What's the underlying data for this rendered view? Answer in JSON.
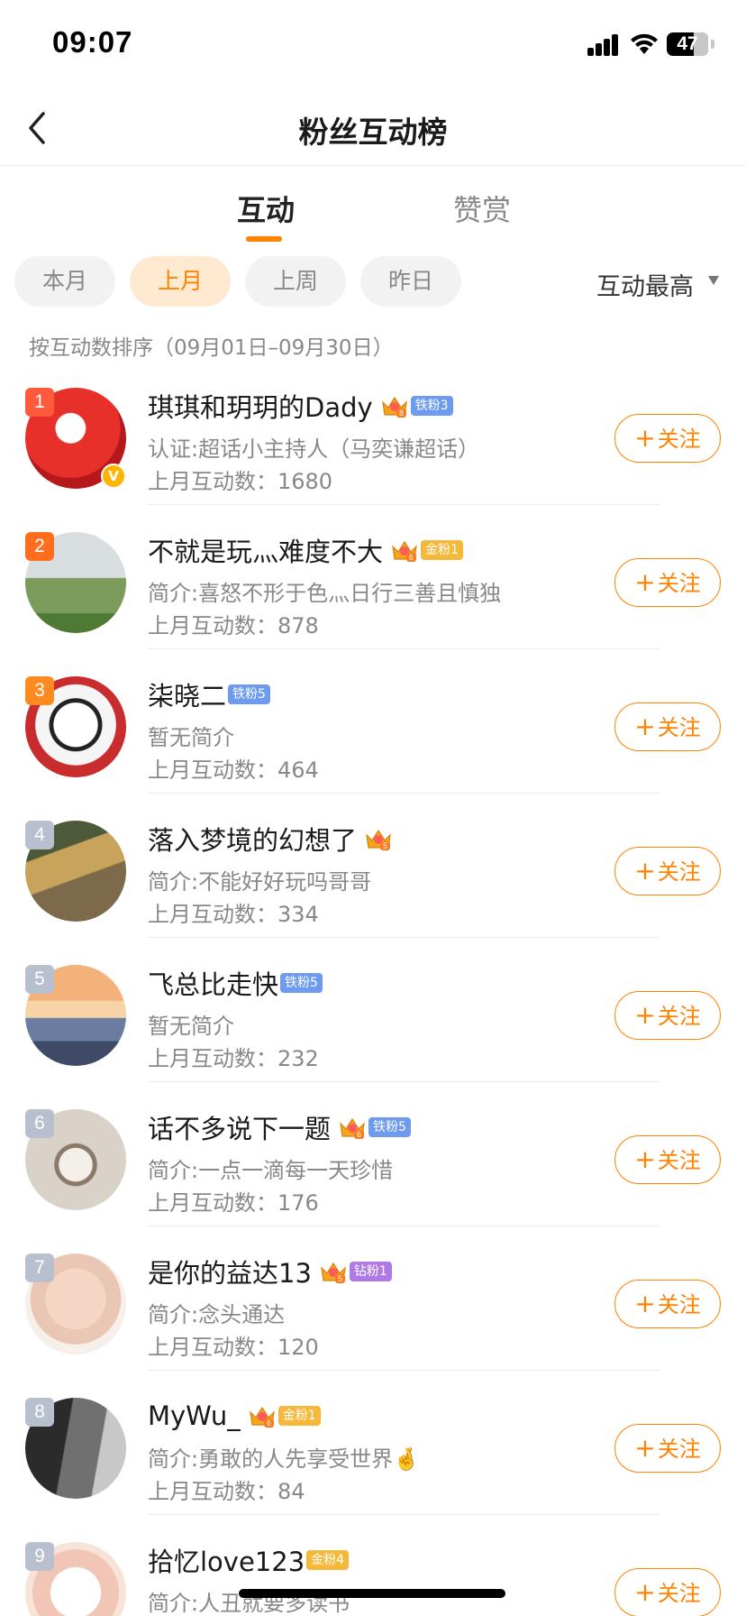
{
  "status_bar": {
    "time": "09:07",
    "battery": "47"
  },
  "nav": {
    "title": "粉丝互动榜"
  },
  "tabs": [
    {
      "label": "互动"
    },
    {
      "label": "赞赏"
    }
  ],
  "filters": {
    "chips": [
      "本月",
      "上月",
      "上周",
      "昨日"
    ],
    "active": "上月",
    "sort_label": "互动最高"
  },
  "date_range": "按互动数排序（09月01日–09月30日）",
  "follow_label": "关注",
  "colors": {
    "accent": "#ff8200",
    "rank_top": "#ff6d1f",
    "rank_other": "#b8bfcf"
  },
  "fans": [
    {
      "rank": "1",
      "name": "琪琪和玥玥的Dady",
      "crown_level": "8",
      "badge": "铁粉3",
      "badge_type": "iron",
      "desc": "认证:超话小主持人（马奕谦超话）",
      "count": "上月互动数：1680",
      "verified": true
    },
    {
      "rank": "2",
      "name": "不就是玩灬难度不大",
      "crown_level": "6",
      "badge": "金粉1",
      "badge_type": "gold",
      "desc": "简介:喜怒不形于色灬日行三善且慎独",
      "count": "上月互动数：878"
    },
    {
      "rank": "3",
      "name": "柒晓二",
      "crown_level": "",
      "badge": "铁粉5",
      "badge_type": "iron",
      "desc": "暂无简介",
      "count": "上月互动数：464"
    },
    {
      "rank": "4",
      "name": "落入梦境的幻想了",
      "crown_level": "5",
      "badge": "",
      "badge_type": "",
      "desc": "简介:不能好好玩吗哥哥",
      "count": "上月互动数：334"
    },
    {
      "rank": "5",
      "name": "飞总比走快",
      "crown_level": "",
      "badge": "铁粉5",
      "badge_type": "iron",
      "desc": "暂无简介",
      "count": "上月互动数：232"
    },
    {
      "rank": "6",
      "name": "话不多说下一题",
      "crown_level": "6",
      "badge": "铁粉5",
      "badge_type": "iron",
      "desc": "简介:一点一滴每一天珍惜",
      "count": "上月互动数：176"
    },
    {
      "rank": "7",
      "name": "是你的益达13",
      "crown_level": "5",
      "badge": "钻粉1",
      "badge_type": "diamond",
      "desc": "简介:念头通达",
      "count": "上月互动数：120"
    },
    {
      "rank": "8",
      "name": "MyWu_",
      "crown_level": "6",
      "badge": "金粉1",
      "badge_type": "gold",
      "desc": "简介:勇敢的人先享受世界🤞",
      "count": "上月互动数：84"
    },
    {
      "rank": "9",
      "name": "拾忆love123",
      "crown_level": "",
      "badge": "金粉4",
      "badge_type": "gold",
      "desc": "简介:人丑就要多读书",
      "count": ""
    }
  ]
}
